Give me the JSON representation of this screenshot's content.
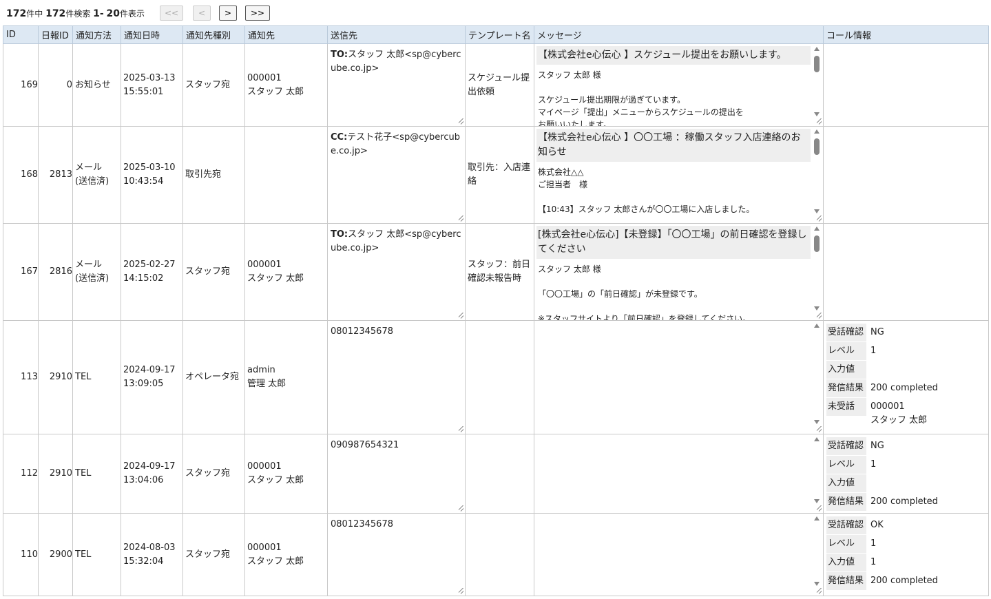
{
  "pager": {
    "total": "172",
    "total_suffix": "件中",
    "found": "172",
    "found_suffix": "件検索",
    "range_start": "1",
    "range_sep": "-",
    "range_end": "20",
    "range_suffix": "件表示",
    "first_label": "<<",
    "prev_label": "<",
    "next_label": ">",
    "last_label": ">>"
  },
  "columns": [
    "ID",
    "日報ID",
    "通知方法",
    "通知日時",
    "通知先種別",
    "通知先",
    "送信先",
    "テンプレート名",
    "メッセージ",
    "コール情報"
  ],
  "rows": [
    {
      "id": "169",
      "report_id": "0",
      "method": "お知らせ",
      "datetime": "2025-03-13\n15:55:01",
      "target_type": "スタッフ宛",
      "target": "000001\nスタッフ 太郎",
      "dest_prefix": "TO:",
      "dest": "スタッフ 太郎<sp@cybercube.co.jp>",
      "template": "スケジュール提出依頼",
      "msg_subject": "【株式会社e心伝心 】スケジュール提出をお願いします。",
      "msg_body": "スタッフ 太郎 様\n\nスケジュール提出期限が過ぎています。\nマイページ「提出」メニューからスケジュールの提出を\nお願いいたします。"
    },
    {
      "id": "168",
      "report_id": "2813",
      "method": "メール\n(送信済)",
      "datetime": "2025-03-10\n10:43:54",
      "target_type": "取引先宛",
      "target": "",
      "dest_prefix": "CC:",
      "dest": "テスト花子<sp@cybercube.co.jp>",
      "template": "取引先：入店連絡",
      "msg_subject": "【株式会社e心伝心 】〇〇工場 ：稼働スタッフ入店連絡のお知らせ",
      "msg_body": "株式会社△△\nご担当者　様\n\n【10:43】スタッフ 太郎さんが〇〇工場に入店しました。"
    },
    {
      "id": "167",
      "report_id": "2816",
      "method": "メール\n(送信済)",
      "datetime": "2025-02-27\n14:15:02",
      "target_type": "スタッフ宛",
      "target": "000001\nスタッフ 太郎",
      "dest_prefix": "TO:",
      "dest": "スタッフ 太郎<sp@cybercube.co.jp>",
      "template": "スタッフ：前日確認未報告時",
      "msg_subject": "[株式会社e心伝心]【未登録】「〇〇工場」の前日確認を登録してください",
      "msg_body": "スタッフ 太郎 様\n\n「〇〇工場」の「前日確認」が未登録です。\n\n※スタッフサイトより「前日確認」を登録してください。"
    },
    {
      "id": "113",
      "report_id": "2910",
      "method": "TEL",
      "datetime": "2024-09-17\n13:09:05",
      "target_type": "オペレータ宛",
      "target": "admin\n管理 太郎",
      "dest_prefix": "",
      "dest": "08012345678",
      "template": "",
      "msg_subject": "",
      "msg_body": "",
      "call": [
        {
          "k": "受話確認",
          "v": "NG"
        },
        {
          "k": "レベル",
          "v": "1"
        },
        {
          "k": "入力値",
          "v": ""
        },
        {
          "k": "発信結果",
          "v": "200 completed"
        },
        {
          "k": "未受話",
          "v": "000001\nスタッフ 太郎"
        }
      ]
    },
    {
      "id": "112",
      "report_id": "2910",
      "method": "TEL",
      "datetime": "2024-09-17\n13:04:06",
      "target_type": "スタッフ宛",
      "target": "000001\nスタッフ 太郎",
      "dest_prefix": "",
      "dest": "090987654321",
      "template": "",
      "msg_subject": "",
      "msg_body": "",
      "call": [
        {
          "k": "受話確認",
          "v": "NG"
        },
        {
          "k": "レベル",
          "v": "1"
        },
        {
          "k": "入力値",
          "v": ""
        },
        {
          "k": "発信結果",
          "v": "200 completed"
        }
      ]
    },
    {
      "id": "110",
      "report_id": "2900",
      "method": "TEL",
      "datetime": "2024-08-03\n15:32:04",
      "target_type": "スタッフ宛",
      "target": "000001\nスタッフ 太郎",
      "dest_prefix": "",
      "dest": "08012345678",
      "template": "",
      "msg_subject": "",
      "msg_body": "",
      "call": [
        {
          "k": "受話確認",
          "v": "OK"
        },
        {
          "k": "レベル",
          "v": "1"
        },
        {
          "k": "入力値",
          "v": "1"
        },
        {
          "k": "発信結果",
          "v": "200 completed"
        }
      ]
    }
  ]
}
